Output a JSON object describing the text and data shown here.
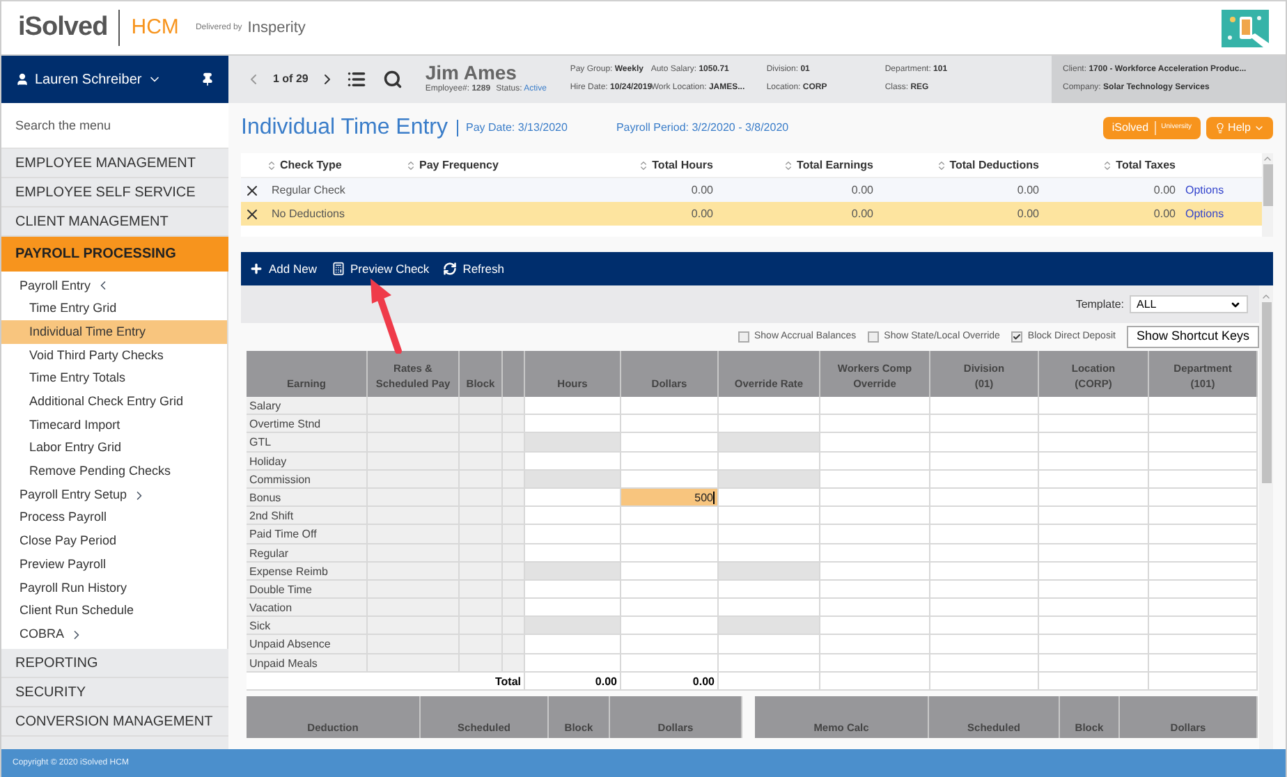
{
  "header": {
    "brand": "iSolved",
    "product": "HCM",
    "delivered_by": "Delivered by",
    "partner": "Insperity"
  },
  "user": {
    "name": "Lauren Schreiber"
  },
  "employee_bar": {
    "position": "1 of 29",
    "name": "Jim Ames",
    "employee_no_label": "Employee#:",
    "employee_no": "1289",
    "status_label": "Status:",
    "status": "Active",
    "fields": [
      {
        "label": "Pay Group:",
        "value": "Weekly"
      },
      {
        "label": "Hire Date:",
        "value": "10/24/2019"
      },
      {
        "label": "Auto Salary:",
        "value": "1050.71"
      },
      {
        "label": "Work Location:",
        "value": "JAMES..."
      },
      {
        "label": "Division:",
        "value": "01"
      },
      {
        "label": "Location:",
        "value": "CORP"
      },
      {
        "label": "Department:",
        "value": "101"
      },
      {
        "label": "Class:",
        "value": "REG"
      }
    ],
    "client": [
      {
        "label": "Client:",
        "value": "1700 - Workforce Acceleration Produc..."
      },
      {
        "label": "Company:",
        "value": "Solar Technology Services"
      }
    ]
  },
  "sidebar": {
    "search_placeholder": "Search the menu",
    "items": [
      {
        "label": "EMPLOYEE MANAGEMENT",
        "selected": false
      },
      {
        "label": "EMPLOYEE SELF SERVICE",
        "selected": false
      },
      {
        "label": "CLIENT MANAGEMENT",
        "selected": false
      },
      {
        "label": "PAYROLL PROCESSING",
        "selected": true,
        "children": [
          {
            "label": "Payroll Entry",
            "selected": false,
            "expanded": true,
            "children": [
              {
                "label": "Time Entry Grid",
                "selected": false
              },
              {
                "label": "Individual Time Entry",
                "selected": true
              },
              {
                "label": "Void Third Party Checks",
                "selected": false
              },
              {
                "label": "Time Entry Totals",
                "selected": false
              },
              {
                "label": "Additional Check Entry Grid",
                "selected": false
              },
              {
                "label": "Timecard Import",
                "selected": false
              },
              {
                "label": "Labor Entry Grid",
                "selected": false
              },
              {
                "label": "Remove Pending Checks",
                "selected": false
              }
            ]
          },
          {
            "label": "Payroll Entry Setup",
            "selected": false,
            "expanded": false
          },
          {
            "label": "Process Payroll",
            "selected": false
          },
          {
            "label": "Close Pay Period",
            "selected": false
          },
          {
            "label": "Preview Payroll",
            "selected": false
          },
          {
            "label": "Payroll Run History",
            "selected": false
          },
          {
            "label": "Client Run Schedule",
            "selected": false
          },
          {
            "label": "COBRA",
            "selected": false,
            "expanded": false
          }
        ]
      },
      {
        "label": "REPORTING",
        "selected": false
      },
      {
        "label": "SECURITY",
        "selected": false
      },
      {
        "label": "CONVERSION MANAGEMENT",
        "selected": false
      }
    ]
  },
  "page": {
    "title": "Individual Time Entry",
    "pay_date": "Pay Date: 3/13/2020",
    "payroll_period": "Payroll Period: 3/2/2020 - 3/8/2020",
    "university": {
      "brand": "iSolved",
      "label": "University"
    },
    "help": "Help"
  },
  "checks": {
    "columns": [
      "Check Type",
      "Pay Frequency",
      "Total Hours",
      "Total Earnings",
      "Total Deductions",
      "Total Taxes"
    ],
    "rows": [
      {
        "check_type": "Regular Check",
        "total_hours": "0.00",
        "total_earnings": "0.00",
        "total_deductions": "0.00",
        "total_taxes": "0.00",
        "action": "Options",
        "selected": false
      },
      {
        "check_type": "No Deductions",
        "total_hours": "0.00",
        "total_earnings": "0.00",
        "total_deductions": "0.00",
        "total_taxes": "0.00",
        "action": "Options",
        "selected": true
      }
    ]
  },
  "toolbar": [
    {
      "label": "Add New",
      "kind": "add"
    },
    {
      "label": "Preview Check",
      "kind": "preview"
    },
    {
      "label": "Refresh",
      "kind": "refresh"
    }
  ],
  "template": {
    "label": "Template:",
    "value": "ALL"
  },
  "options": [
    {
      "label": "Show Accrual Balances",
      "checked": false
    },
    {
      "label": "Show State/Local Override",
      "checked": false
    },
    {
      "label": "Block Direct Deposit",
      "checked": true
    }
  ],
  "shortcut_button": "Show Shortcut Keys",
  "earnings": {
    "columns": [
      {
        "kind": "label",
        "lines": [
          "Earning"
        ]
      },
      {
        "kind": "locked",
        "lines": [
          "Rates &",
          "Scheduled Pay"
        ]
      },
      {
        "kind": "locked",
        "lines": [
          "Block"
        ]
      },
      {
        "kind": "spacer"
      },
      {
        "kind": "hours",
        "lines": [
          "Hours"
        ]
      },
      {
        "kind": "dollars",
        "lines": [
          "Dollars"
        ]
      },
      {
        "kind": "rate",
        "lines": [
          "Override Rate"
        ]
      },
      {
        "kind": "open",
        "lines": [
          "Workers Comp",
          "Override"
        ]
      },
      {
        "kind": "open",
        "lines": [
          "Division",
          "(01)"
        ]
      },
      {
        "kind": "open",
        "lines": [
          "Location",
          "(CORP)"
        ]
      },
      {
        "kind": "open",
        "lines": [
          "Department",
          "(101)"
        ]
      }
    ],
    "rows": [
      {
        "earning": "Salary",
        "locked": false
      },
      {
        "earning": "Overtime Stnd",
        "locked": false
      },
      {
        "earning": "GTL",
        "locked": true
      },
      {
        "earning": "Holiday",
        "locked": false
      },
      {
        "earning": "Commission",
        "locked": true
      },
      {
        "earning": "Bonus",
        "locked": false,
        "dollars": "500",
        "active": true
      },
      {
        "earning": "2nd Shift",
        "locked": false
      },
      {
        "earning": "Paid Time Off",
        "locked": false
      },
      {
        "earning": "Regular",
        "locked": false
      },
      {
        "earning": "Expense Reimb",
        "locked": true
      },
      {
        "earning": "Double Time",
        "locked": false
      },
      {
        "earning": "Vacation",
        "locked": false
      },
      {
        "earning": "Sick",
        "locked": true
      },
      {
        "earning": "Unpaid Absence",
        "locked": false
      },
      {
        "earning": "Unpaid Meals",
        "locked": false
      }
    ],
    "total": {
      "label": "Total",
      "hours": "0.00",
      "dollars": "0.00"
    }
  },
  "deductions": {
    "columns": [
      "Deduction",
      "Scheduled",
      "Block",
      "Dollars"
    ]
  },
  "memos": {
    "columns": [
      "Memo Calc",
      "Scheduled",
      "Block",
      "Dollars"
    ]
  },
  "footer": "Copyright © 2020 iSolved HCM"
}
